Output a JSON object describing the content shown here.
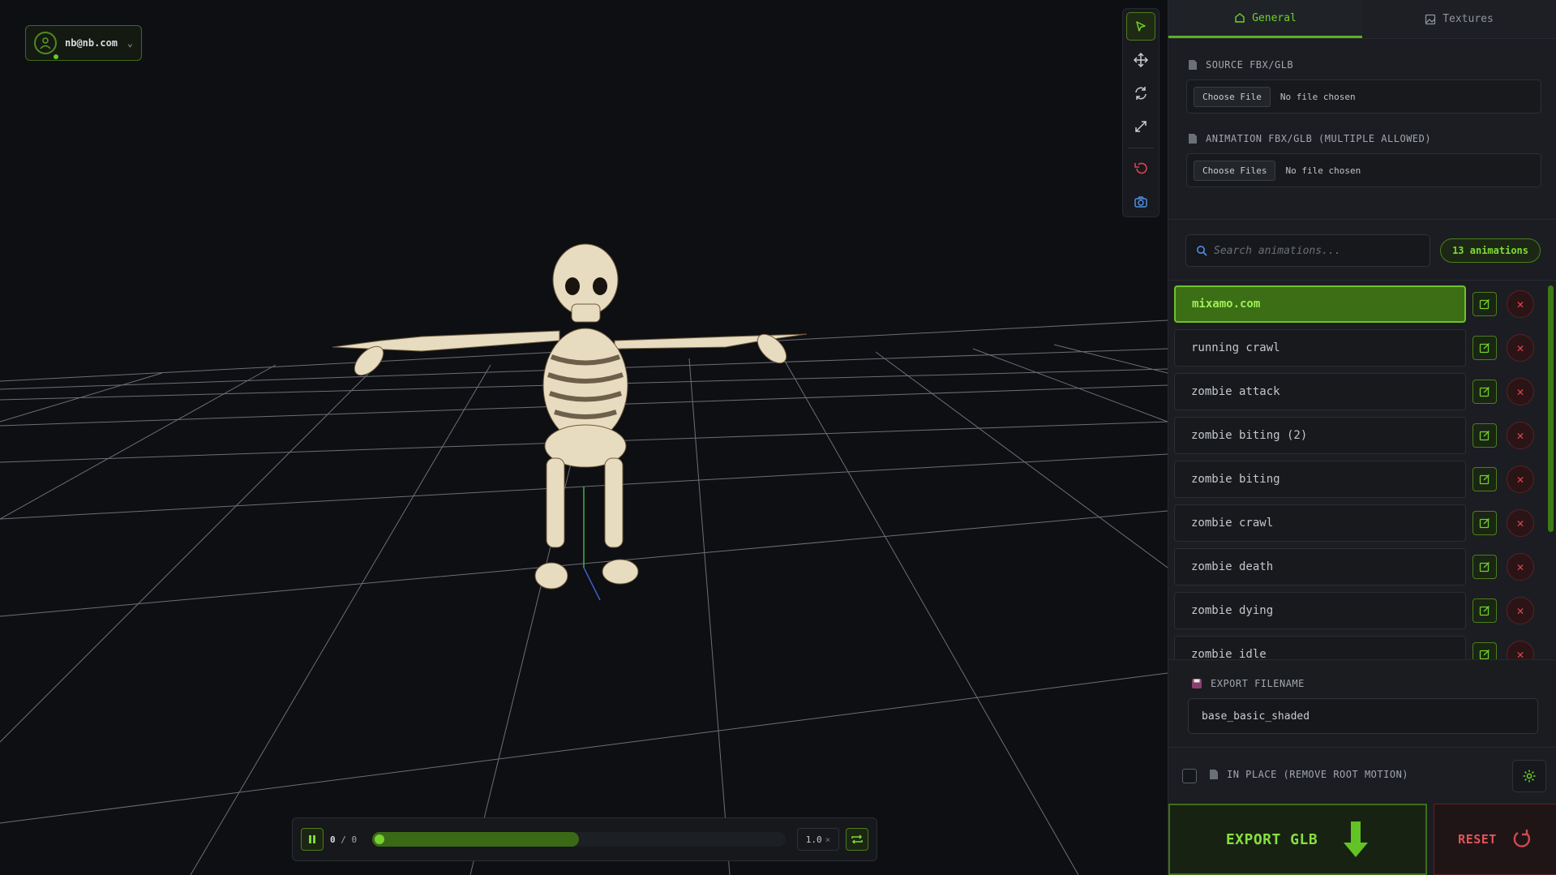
{
  "user": {
    "email": "nb@nb.com",
    "status_color": "#6dc72a"
  },
  "toolbar": {
    "tools": [
      "select-icon",
      "move-icon",
      "rotate-icon",
      "scale-icon",
      "undo-icon",
      "camera-icon"
    ]
  },
  "playback": {
    "current_frame": "0",
    "separator": "/",
    "total_frames": "0",
    "speed": "1.0",
    "speed_suffix": "×",
    "progress": 0.5
  },
  "panel": {
    "tabs": [
      {
        "label": "General",
        "active": true
      },
      {
        "label": "Textures",
        "active": false
      }
    ],
    "source": {
      "label": "SOURCE FBX/GLB",
      "button": "Choose File",
      "status": "No file chosen"
    },
    "animation": {
      "label": "ANIMATION FBX/GLB (MULTIPLE ALLOWED)",
      "button": "Choose Files",
      "status": "No file chosen"
    },
    "search": {
      "placeholder": "Search animations..."
    },
    "count": "13 animations",
    "animations": [
      {
        "name": "mixamo.com",
        "selected": true
      },
      {
        "name": "running crawl",
        "selected": false
      },
      {
        "name": "zombie attack",
        "selected": false
      },
      {
        "name": "zombie biting (2)",
        "selected": false
      },
      {
        "name": "zombie biting",
        "selected": false
      },
      {
        "name": "zombie crawl",
        "selected": false
      },
      {
        "name": "zombie death",
        "selected": false
      },
      {
        "name": "zombie dying",
        "selected": false
      },
      {
        "name": "zombie idle",
        "selected": false
      }
    ],
    "export_filename": {
      "label": "EXPORT FILENAME",
      "value": "base_basic_shaded"
    },
    "in_place": {
      "label": "IN PLACE (REMOVE ROOT MOTION)",
      "checked": false
    },
    "export_button": "EXPORT GLB",
    "reset_button": "RESET"
  },
  "colors": {
    "accent": "#6fd12b",
    "danger": "#e2484e",
    "background": "#0e0f13"
  }
}
